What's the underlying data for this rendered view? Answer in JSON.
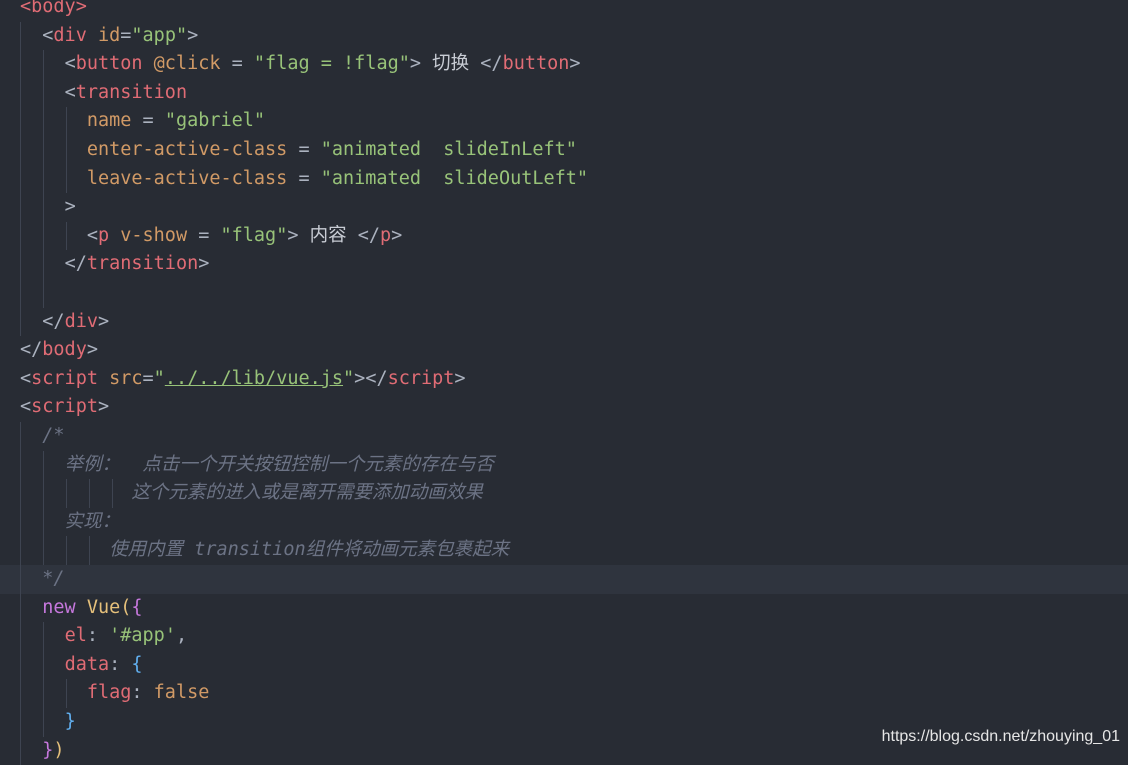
{
  "colors": {
    "background": "#282c34",
    "tag": "#e06c75",
    "attribute": "#d19a66",
    "string": "#98c379",
    "comment": "#6c7385",
    "keyword": "#c678dd",
    "class": "#e5c07b"
  },
  "lines": [
    {
      "guides": [],
      "tokens": [
        {
          "t": "<body>",
          "c": "tag"
        }
      ]
    },
    {
      "guides": [
        20
      ],
      "tokens": [
        {
          "t": "  "
        },
        {
          "t": "<",
          "c": "punc"
        },
        {
          "t": "div",
          "c": "tag"
        },
        {
          "t": " "
        },
        {
          "t": "id",
          "c": "attr"
        },
        {
          "t": "=",
          "c": "punc"
        },
        {
          "t": "\"app\"",
          "c": "str"
        },
        {
          "t": ">",
          "c": "punc"
        }
      ]
    },
    {
      "guides": [
        20,
        43
      ],
      "tokens": [
        {
          "t": "    "
        },
        {
          "t": "<",
          "c": "punc"
        },
        {
          "t": "button",
          "c": "tag"
        },
        {
          "t": " "
        },
        {
          "t": "@click",
          "c": "attr"
        },
        {
          "t": " = ",
          "c": "punc"
        },
        {
          "t": "\"flag = !flag\"",
          "c": "str"
        },
        {
          "t": ">",
          "c": "punc"
        },
        {
          "t": " 切换 ",
          "c": "text"
        },
        {
          "t": "</",
          "c": "punc"
        },
        {
          "t": "button",
          "c": "tag"
        },
        {
          "t": ">",
          "c": "punc"
        }
      ]
    },
    {
      "guides": [
        20,
        43
      ],
      "tokens": [
        {
          "t": "    "
        },
        {
          "t": "<",
          "c": "punc"
        },
        {
          "t": "transition",
          "c": "tag"
        }
      ]
    },
    {
      "guides": [
        20,
        43,
        66
      ],
      "tokens": [
        {
          "t": "      "
        },
        {
          "t": "name",
          "c": "attr"
        },
        {
          "t": " = ",
          "c": "punc"
        },
        {
          "t": "\"gabriel\"",
          "c": "str"
        }
      ]
    },
    {
      "guides": [
        20,
        43,
        66
      ],
      "tokens": [
        {
          "t": "      "
        },
        {
          "t": "enter-active-class",
          "c": "attr"
        },
        {
          "t": " = ",
          "c": "punc"
        },
        {
          "t": "\"animated  slideInLeft\"",
          "c": "str"
        }
      ]
    },
    {
      "guides": [
        20,
        43,
        66
      ],
      "tokens": [
        {
          "t": "      "
        },
        {
          "t": "leave-active-class",
          "c": "attr"
        },
        {
          "t": " = ",
          "c": "punc"
        },
        {
          "t": "\"animated  slideOutLeft\"",
          "c": "str"
        }
      ]
    },
    {
      "guides": [
        20,
        43
      ],
      "tokens": [
        {
          "t": "    "
        },
        {
          "t": ">",
          "c": "punc"
        }
      ]
    },
    {
      "guides": [
        20,
        43,
        66
      ],
      "tokens": [
        {
          "t": "      "
        },
        {
          "t": "<",
          "c": "punc"
        },
        {
          "t": "p",
          "c": "tag"
        },
        {
          "t": " "
        },
        {
          "t": "v-show",
          "c": "attr"
        },
        {
          "t": " = ",
          "c": "punc"
        },
        {
          "t": "\"flag\"",
          "c": "str"
        },
        {
          "t": ">",
          "c": "punc"
        },
        {
          "t": " 内容 ",
          "c": "text"
        },
        {
          "t": "</",
          "c": "punc"
        },
        {
          "t": "p",
          "c": "tag"
        },
        {
          "t": ">",
          "c": "punc"
        }
      ]
    },
    {
      "guides": [
        20,
        43
      ],
      "tokens": [
        {
          "t": "    "
        },
        {
          "t": "</",
          "c": "punc"
        },
        {
          "t": "transition",
          "c": "tag"
        },
        {
          "t": ">",
          "c": "punc"
        }
      ]
    },
    {
      "guides": [
        20,
        43
      ],
      "tokens": []
    },
    {
      "guides": [
        20
      ],
      "tokens": [
        {
          "t": "  "
        },
        {
          "t": "</",
          "c": "punc"
        },
        {
          "t": "div",
          "c": "tag"
        },
        {
          "t": ">",
          "c": "punc"
        }
      ]
    },
    {
      "guides": [],
      "tokens": [
        {
          "t": "</",
          "c": "punc"
        },
        {
          "t": "body",
          "c": "tag"
        },
        {
          "t": ">",
          "c": "punc"
        }
      ]
    },
    {
      "guides": [],
      "tokens": [
        {
          "t": "<",
          "c": "punc"
        },
        {
          "t": "script",
          "c": "tag"
        },
        {
          "t": " "
        },
        {
          "t": "src",
          "c": "attr"
        },
        {
          "t": "=",
          "c": "punc"
        },
        {
          "t": "\"",
          "c": "str"
        },
        {
          "t": "../../lib/vue.js",
          "c": "link"
        },
        {
          "t": "\"",
          "c": "str"
        },
        {
          "t": ">",
          "c": "punc"
        },
        {
          "t": "</",
          "c": "punc"
        },
        {
          "t": "script",
          "c": "tag"
        },
        {
          "t": ">",
          "c": "punc"
        }
      ]
    },
    {
      "guides": [],
      "tokens": [
        {
          "t": "<",
          "c": "punc"
        },
        {
          "t": "script",
          "c": "tag"
        },
        {
          "t": ">",
          "c": "punc"
        }
      ]
    },
    {
      "guides": [
        20
      ],
      "tokens": [
        {
          "t": "  "
        },
        {
          "t": "/*",
          "c": "cmt"
        }
      ]
    },
    {
      "guides": [
        20,
        43
      ],
      "tokens": [
        {
          "t": "    "
        },
        {
          "t": "举例：  点击一个开关按钮控制一个元素的存在与否",
          "c": "cmt"
        }
      ]
    },
    {
      "guides": [
        20,
        43,
        66,
        89,
        112
      ],
      "tokens": [
        {
          "t": "          "
        },
        {
          "t": "这个元素的进入或是离开需要添加动画效果",
          "c": "cmt"
        }
      ]
    },
    {
      "guides": [
        20,
        43
      ],
      "tokens": [
        {
          "t": "    "
        },
        {
          "t": "实现：",
          "c": "cmt"
        }
      ]
    },
    {
      "guides": [
        20,
        43,
        66,
        89
      ],
      "tokens": [
        {
          "t": "        "
        },
        {
          "t": "使用内置 transition组件将动画元素包裹起来",
          "c": "cmt"
        }
      ]
    },
    {
      "guides": [
        20
      ],
      "highlight": true,
      "tokens": [
        {
          "t": "  "
        },
        {
          "t": "*/",
          "c": "cmt"
        }
      ]
    },
    {
      "guides": [
        20
      ],
      "tokens": [
        {
          "t": "  "
        },
        {
          "t": "new",
          "c": "kw"
        },
        {
          "t": " "
        },
        {
          "t": "Vue",
          "c": "cls"
        },
        {
          "t": "(",
          "c": "br1"
        },
        {
          "t": "{",
          "c": "kw"
        }
      ]
    },
    {
      "guides": [
        20,
        43
      ],
      "tokens": [
        {
          "t": "    "
        },
        {
          "t": "el",
          "c": "prop"
        },
        {
          "t": ": ",
          "c": "punc"
        },
        {
          "t": "'#app'",
          "c": "str"
        },
        {
          "t": ",",
          "c": "punc"
        }
      ]
    },
    {
      "guides": [
        20,
        43
      ],
      "tokens": [
        {
          "t": "    "
        },
        {
          "t": "data",
          "c": "prop"
        },
        {
          "t": ": ",
          "c": "punc"
        },
        {
          "t": "{",
          "c": "br2"
        }
      ]
    },
    {
      "guides": [
        20,
        43,
        66
      ],
      "tokens": [
        {
          "t": "      "
        },
        {
          "t": "flag",
          "c": "prop"
        },
        {
          "t": ": ",
          "c": "punc"
        },
        {
          "t": "false",
          "c": "bool"
        }
      ]
    },
    {
      "guides": [
        20,
        43
      ],
      "tokens": [
        {
          "t": "    "
        },
        {
          "t": "}",
          "c": "br2"
        }
      ]
    },
    {
      "guides": [
        20
      ],
      "tokens": [
        {
          "t": "  "
        },
        {
          "t": "}",
          "c": "kw"
        },
        {
          "t": ")",
          "c": "br1"
        }
      ]
    }
  ],
  "watermark": "https://blog.csdn.net/zhouying_01"
}
